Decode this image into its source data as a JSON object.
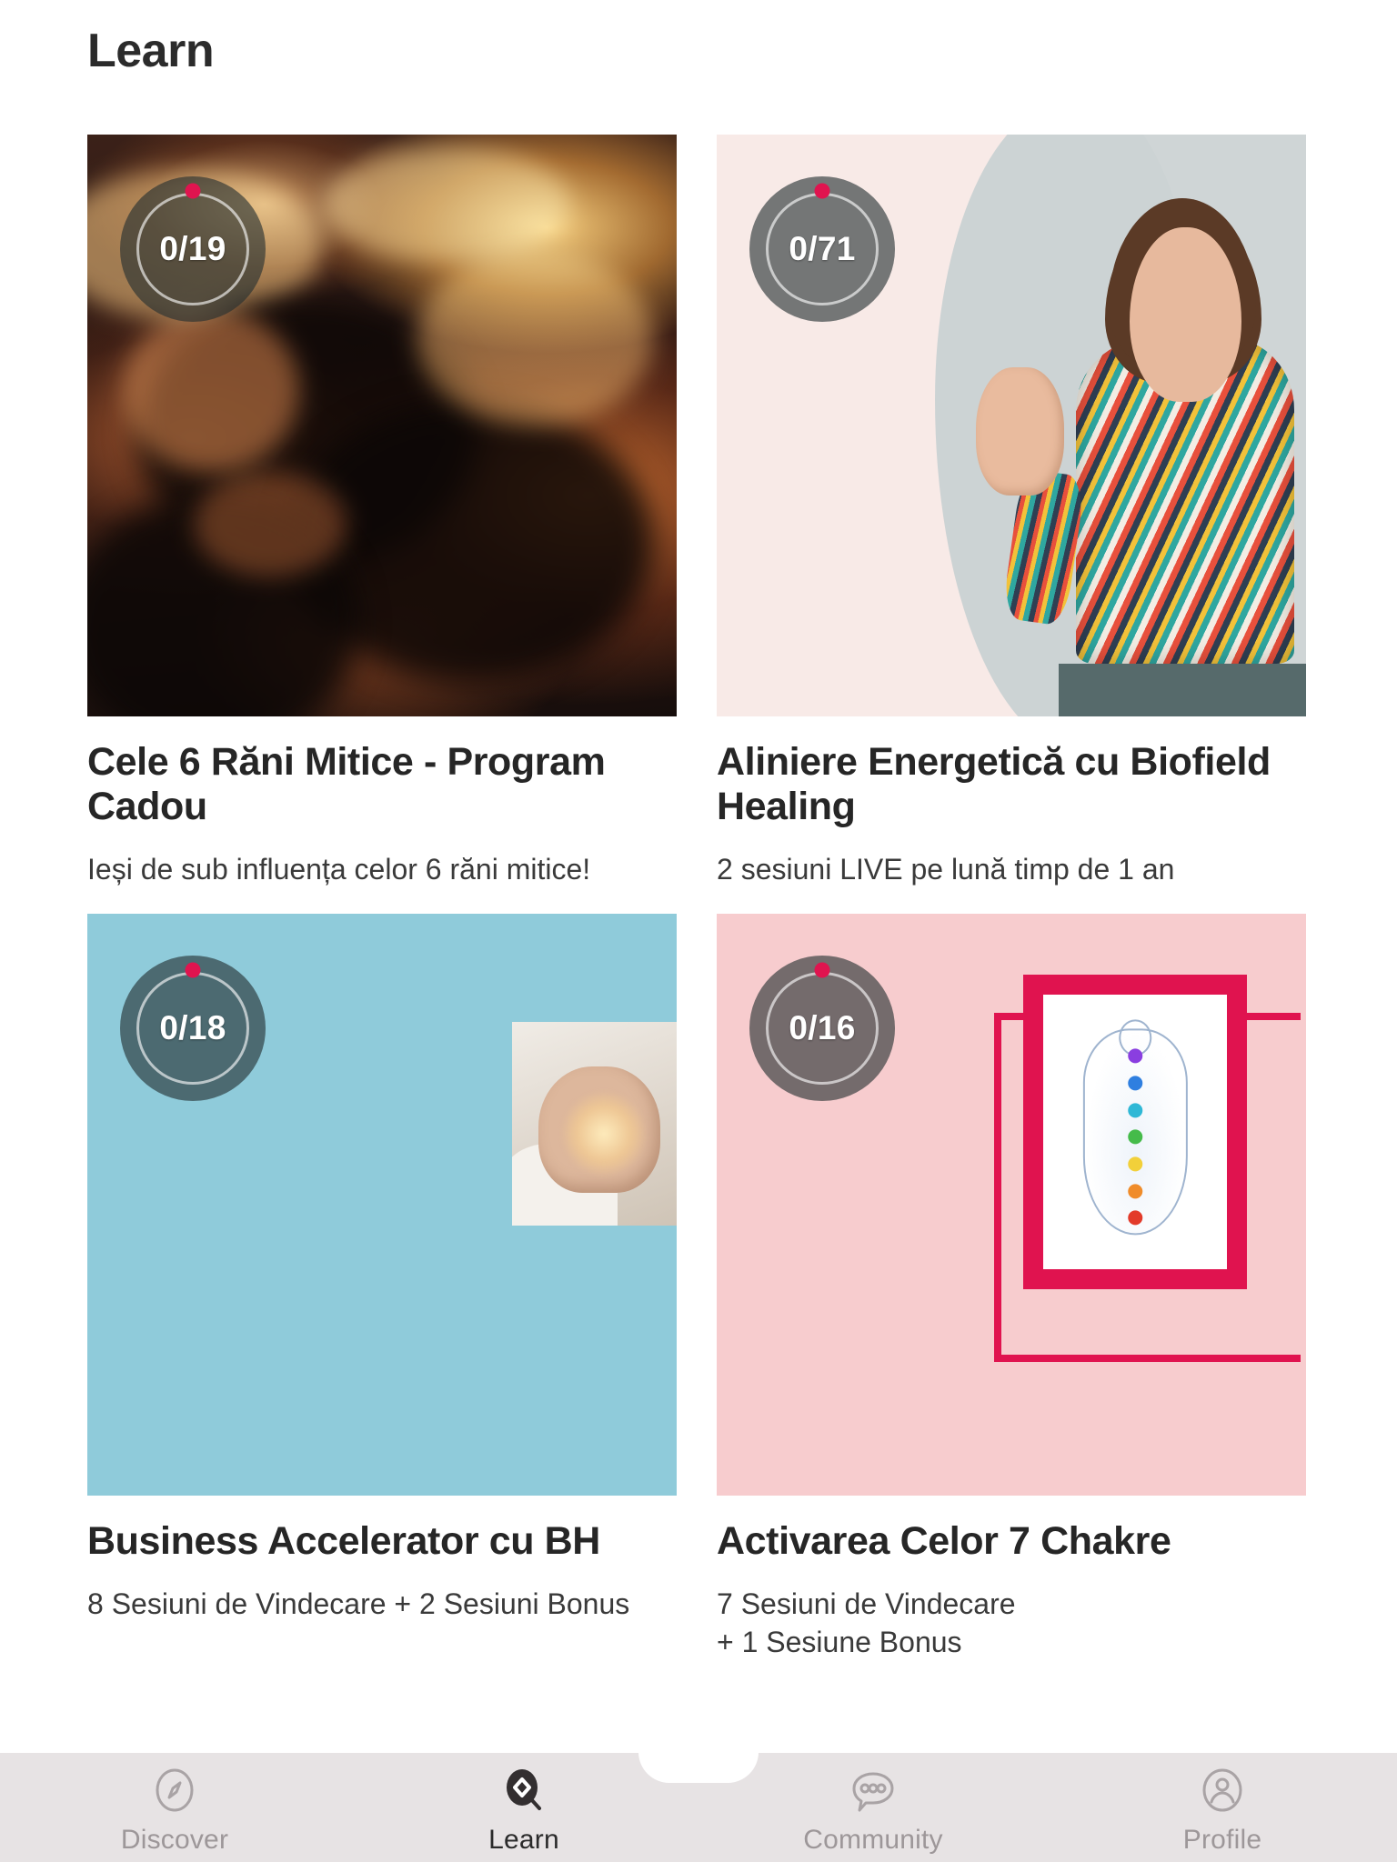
{
  "header": {
    "title": "Learn"
  },
  "colors": {
    "accent_dot": "#e0144f",
    "nav_background": "#e7e3e4",
    "nav_active_text": "#2b2b2b",
    "nav_inactive_text": "#9d9799",
    "card_teal": "#8fcbda",
    "card_pink": "#f7ccce",
    "chakra_frame": "#e0134f",
    "page_background": "#ffffff"
  },
  "courses": [
    {
      "progress": "0/19",
      "title": "Cele 6 Răni Mitice - Program Cadou",
      "subtitle": "Ieși de sub influența celor 6 răni mitice!",
      "thumbnail": "storm-clouds-sunset-photo"
    },
    {
      "progress": "0/71",
      "title": "Aliniere Energetică cu Biofield Healing",
      "subtitle": "2 sesiuni LIVE pe lună timp de 1 an",
      "thumbnail": "woman-waving-portrait-photo"
    },
    {
      "progress": "0/18",
      "title": "Business Accelerator cu BH",
      "subtitle": "8 Sesiuni de Vindecare + 2 Sesiuni Bonus",
      "thumbnail": "teal-panel-with-glowing-hand-photo"
    },
    {
      "progress": "0/16",
      "title": "Activarea Celor 7 Chakre",
      "subtitle": "7 Sesiuni de Vindecare\n+ 1 Sesiune Bonus",
      "thumbnail": "pink-panel-chakra-figure-poster"
    }
  ],
  "bottom_nav": {
    "items": [
      {
        "label": "Discover",
        "icon": "compass-icon",
        "active": false
      },
      {
        "label": "Learn",
        "icon": "diamond-search-icon",
        "active": true
      },
      {
        "label": "Community",
        "icon": "chat-bubble-icon",
        "active": false
      },
      {
        "label": "Profile",
        "icon": "person-circle-icon",
        "active": false
      }
    ]
  }
}
